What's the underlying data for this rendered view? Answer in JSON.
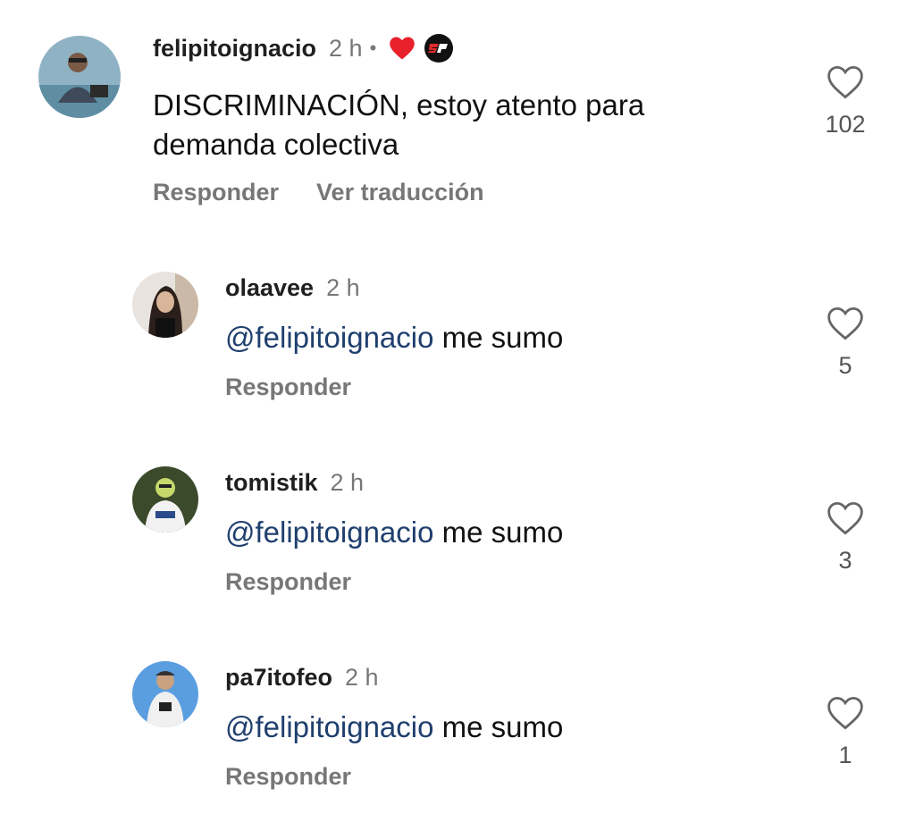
{
  "comments": [
    {
      "user": "felipitoignacio",
      "time": "2 h",
      "separator": "•",
      "text": "DISCRIMINACIÓN, estoy atento para demanda colectiva",
      "actions": {
        "reply": "Responder",
        "translate": "Ver traducción"
      },
      "likes": "102",
      "badges": [
        "heart-icon",
        "sp-logo-icon"
      ]
    },
    {
      "user": "olaavee",
      "time": "2 h",
      "mention": "@felipitoignacio",
      "text": " me sumo",
      "actions": {
        "reply": "Responder"
      },
      "likes": "5"
    },
    {
      "user": "tomistik",
      "time": "2 h",
      "mention": "@felipitoignacio",
      "text": " me sumo",
      "actions": {
        "reply": "Responder"
      },
      "likes": "3"
    },
    {
      "user": "pa7itofeo",
      "time": "2 h",
      "mention": "@felipitoignacio",
      "text": " me sumo",
      "actions": {
        "reply": "Responder"
      },
      "likes": "1"
    }
  ],
  "colors": {
    "heart_badge": "#e8202a",
    "mention": "#1f3f6e",
    "muted": "#777777"
  }
}
